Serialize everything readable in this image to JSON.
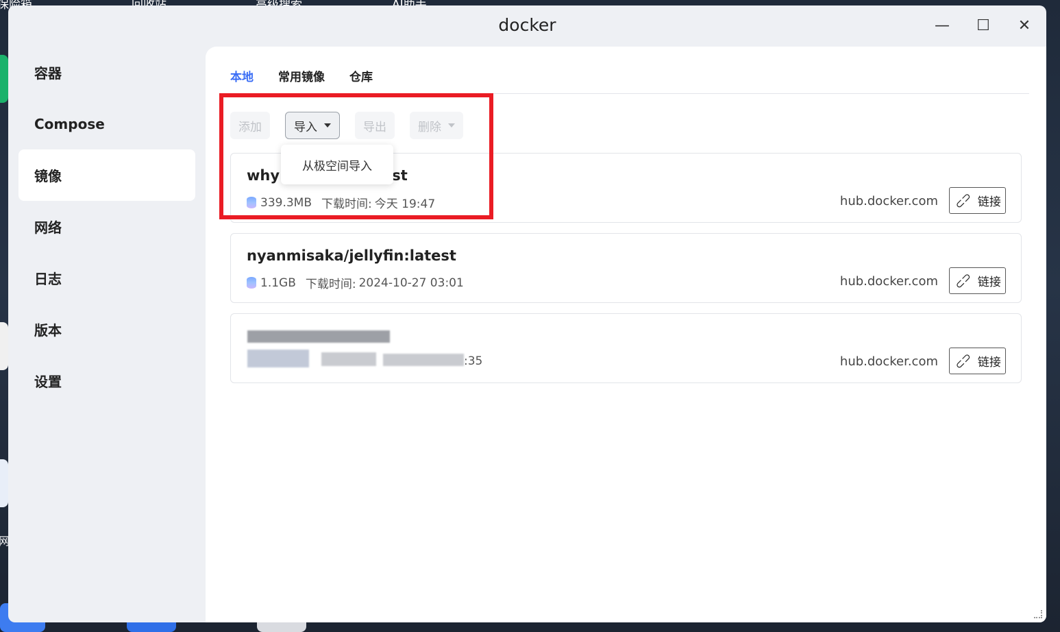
{
  "desktop": {
    "labels": [
      "保险箱",
      "回收站",
      "高级搜索",
      "AI助手"
    ],
    "side_fragment": "网"
  },
  "window": {
    "title": "docker",
    "controls": {
      "minimize": "—",
      "maximize": "☐",
      "close": "✕"
    }
  },
  "sidebar": {
    "items": [
      {
        "label": "容器"
      },
      {
        "label": "Compose"
      },
      {
        "label": "镜像",
        "active": true
      },
      {
        "label": "网络"
      },
      {
        "label": "日志"
      },
      {
        "label": "版本"
      },
      {
        "label": "设置"
      }
    ]
  },
  "tabs": [
    {
      "label": "本地",
      "active": true
    },
    {
      "label": "常用镜像"
    },
    {
      "label": "仓库"
    }
  ],
  "toolbar": {
    "add": "添加",
    "import": "导入",
    "export": "导出",
    "delete": "删除"
  },
  "import_menu": {
    "items": [
      "从极空间导入"
    ]
  },
  "images": [
    {
      "name_visible_start": "why",
      "name_visible_end": "est",
      "size": "339.3MB",
      "download_label": "下载时间:",
      "download_time": "今天 19:47",
      "source": "hub.docker.com",
      "link_label": "链接"
    },
    {
      "name": "nyanmisaka/jellyfin:latest",
      "size": "1.1GB",
      "download_label": "下载时间:",
      "download_time": "2024-10-27 03:01",
      "source": "hub.docker.com",
      "link_label": "链接"
    },
    {
      "visible_meta_tail": ":35",
      "source": "hub.docker.com",
      "link_label": "链接"
    }
  ],
  "colors": {
    "accent": "#3b6ef5",
    "highlight": "#ea1c24"
  }
}
